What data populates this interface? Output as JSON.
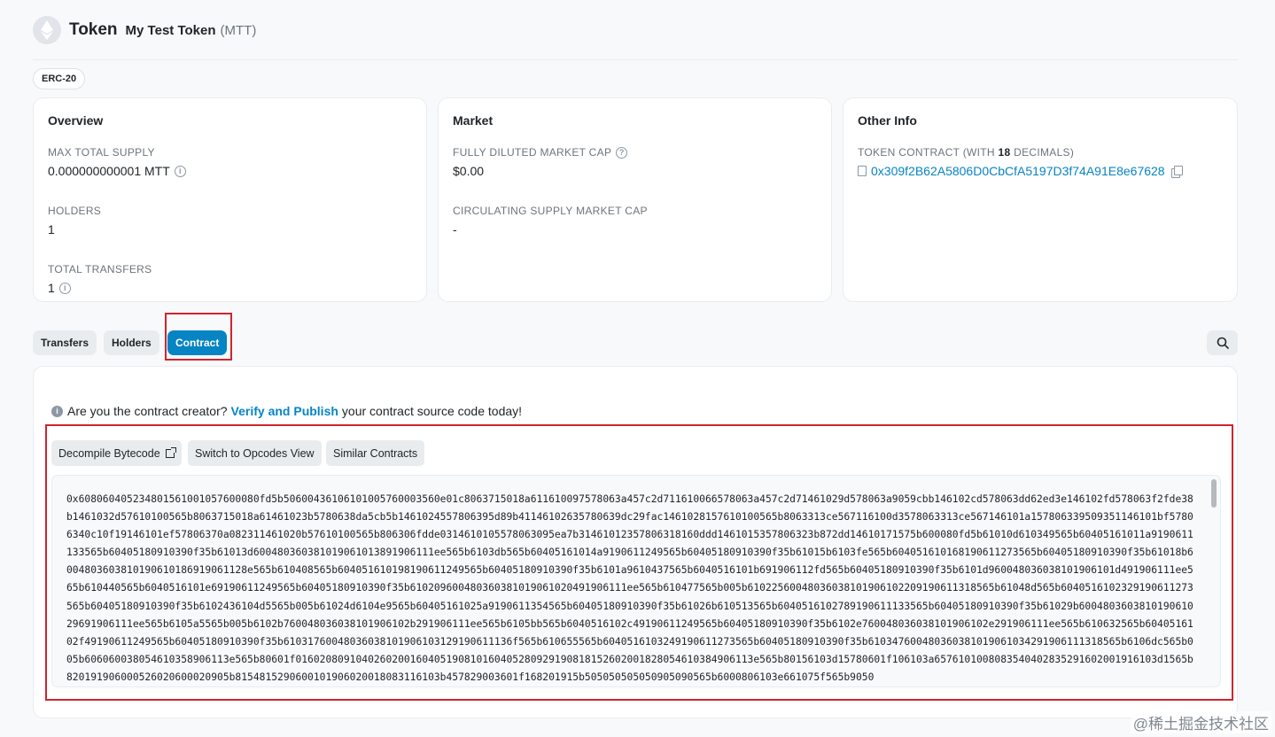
{
  "header": {
    "title": "Token",
    "token_name": "My Test Token",
    "token_symbol": "(MTT)",
    "logo_icon": "ethereum-logo-icon"
  },
  "badge": "ERC-20",
  "overview": {
    "title": "Overview",
    "max_supply_label": "MAX TOTAL SUPPLY",
    "max_supply_value": "0.000000000001 MTT",
    "holders_label": "HOLDERS",
    "holders_value": "1",
    "transfers_label": "TOTAL TRANSFERS",
    "transfers_value": "1"
  },
  "market": {
    "title": "Market",
    "fdmc_label": "FULLY DILUTED MARKET CAP",
    "fdmc_value": "$0.00",
    "csmc_label": "CIRCULATING SUPPLY MARKET CAP",
    "csmc_value": "-"
  },
  "other_info": {
    "title": "Other Info",
    "contract_label_prefix": "TOKEN CONTRACT (WITH ",
    "contract_decimals": "18",
    "contract_label_suffix": " DECIMALS)",
    "contract_address": "0x309f2B62A5806D0CbCfA5197D3f74A91E8e67628"
  },
  "tabs": [
    {
      "label": "Transfers",
      "active": false
    },
    {
      "label": "Holders",
      "active": false
    },
    {
      "label": "Contract",
      "active": true
    }
  ],
  "contract": {
    "creator_prefix": "Are you the contract creator?",
    "creator_link": "Verify and Publish",
    "creator_suffix": "your contract source code today!",
    "decompile_label": "Decompile Bytecode",
    "opcodes_label": "Switch to Opcodes View",
    "similar_label": "Similar Contracts",
    "bytecode": "0x608060405234801561001057600080fd5b50600436106101005760003560e01c8063715018a611610097578063a457c2d711610066578063a457c2d71461029d578063a9059cbb146102cd578063dd62ed3e146102fd578063f2fde38b1461032d57610100565b8063715018a61461023b5780638da5cb5b1461024557806395d89b41146102635780639dc29fac1461028157610100565b8063313ce567116100d357806331 3ce567146101a15780633950935114610 1bf57806340c10f19146101ef57806370a082311461020b57610100565b806306fdde0314610105578063095ea7b31461012357806318160ddd146101535780632 3b872dd14610171575b600080fd5b61010d610349565b60405161011a9190611133565b60405180910390f35b61013d60048036038101906101389190611 1ee565b6103db565b60405161014a9190611249565b60405180910390f35b61015b6103fe565b6040516101681906112 73565b60405180910390f35b61018b60048036038101906101869190611 28e565b610408565b6040516101981906112 49565b60405180910390f35b6101a9610437565b6040516101b691906112fd565b60405180910390f35b6101d960048036038101906101d4919061 11ee565b610440565b6040516101e69190611249565b60405180910390f35b6102096004803603810190610204919061 11ee565b610477565b005b61022560048036038101906102209190611318565b61048d565b6040516102329190611 273565b60405180910390f35b6102436104d5565b005b61024d6104e9565b60405161025a9190611354565b60405180910390f35b61026b610513565b604051610278919061 1133565b60405180910390f35b61029b60048036038101906102969190611 1ee565b6105a556 5b005b6102b76004803603810190610 2b2919061 11ee565b6105bb565b6040516102c49190611249565b60405180910390f35b6102e76004803603810190610 2e29190611 1ee565b610632565b6040516102f49190611249565b60405180910390f35b61031760048036038101906103129190611136f565b610655565b6040516103249190611273565b60405180910390f35b6103476004803603810190610342919061 1131856 5b6106dc565b005b60606003805461035890611 3e565b80601f016020809104026020016040519081016040528092919081815260200182805461038490611 3e565b80156103d15780601f106103a657610100808354040283529160200191 6103d1565b820191906000526020600020905b8154815290600101906020018083116103b457829003601f168201915b505050505050905090565b6000806103e661075f565b9050"
  },
  "watermark": "@稀土掘金技术社区"
}
